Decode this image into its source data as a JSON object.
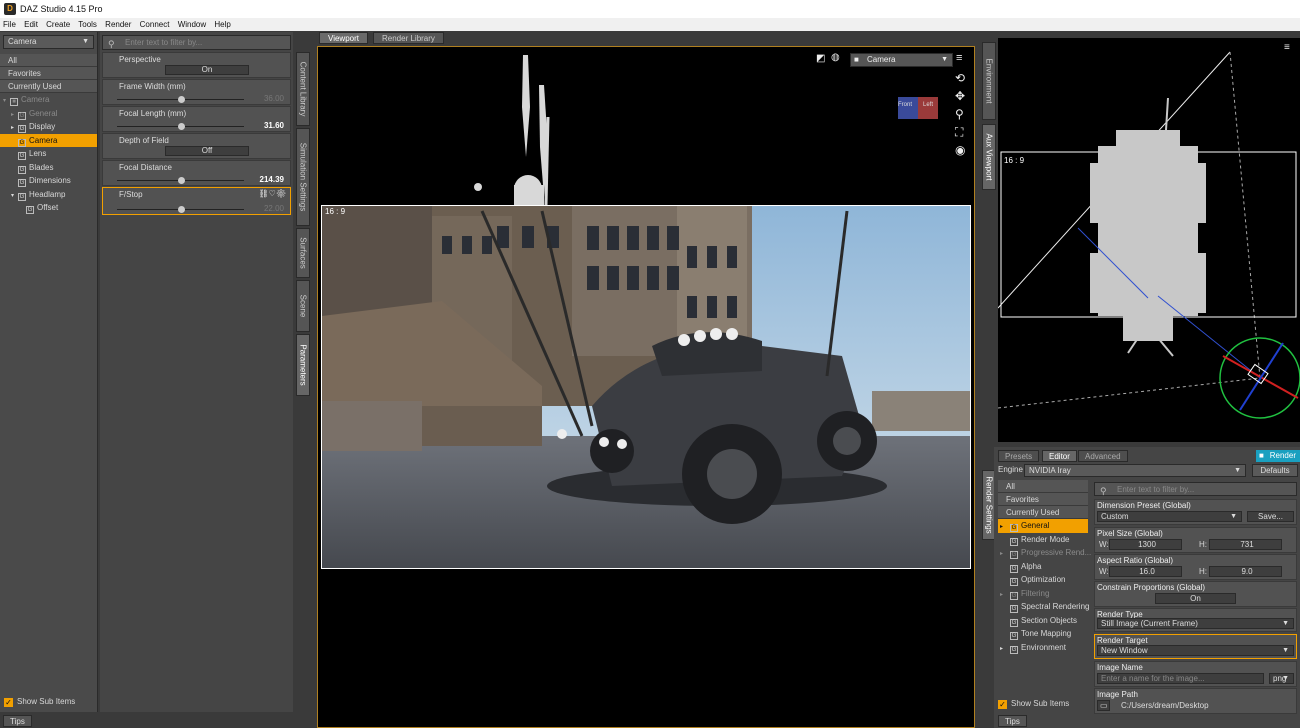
{
  "app": {
    "title": "DAZ Studio 4.15 Pro"
  },
  "menu": [
    "File",
    "Edit",
    "Create",
    "Tools",
    "Render",
    "Connect",
    "Window",
    "Help"
  ],
  "left_nav": {
    "node_select": "Camera",
    "categories": [
      "All",
      "Favorites",
      "Currently Used"
    ],
    "tree": [
      {
        "label": "Camera",
        "state": "dim",
        "expander": "▾",
        "indent": 0,
        "icon": "camera-icon"
      },
      {
        "label": "General",
        "state": "dim",
        "expander": "▸",
        "indent": 1,
        "icon": "group-icon"
      },
      {
        "label": "Display",
        "state": "normal",
        "expander": "▸",
        "indent": 1,
        "icon": "group-icon"
      },
      {
        "label": "Camera",
        "state": "selected",
        "expander": "",
        "indent": 1,
        "icon": "group-icon"
      },
      {
        "label": "Lens",
        "state": "normal",
        "expander": "",
        "indent": 1,
        "icon": "group-icon"
      },
      {
        "label": "Blades",
        "state": "normal",
        "expander": "",
        "indent": 1,
        "icon": "group-icon"
      },
      {
        "label": "Dimensions",
        "state": "normal",
        "expander": "",
        "indent": 1,
        "icon": "group-icon"
      },
      {
        "label": "Headlamp",
        "state": "normal",
        "expander": "▾",
        "indent": 1,
        "icon": "group-icon"
      },
      {
        "label": "Offset",
        "state": "normal",
        "expander": "",
        "indent": 2,
        "icon": "group-icon"
      }
    ],
    "show_sub_items": "Show Sub Items",
    "tips": "Tips"
  },
  "params": {
    "search_placeholder": "Enter text to filter by...",
    "items": [
      {
        "label": "Perspective",
        "kind": "toggle",
        "value": "On"
      },
      {
        "label": "Frame Width (mm)",
        "kind": "slider",
        "value": "36.00",
        "level": 0.5,
        "highlight": false
      },
      {
        "label": "Focal Length (mm)",
        "kind": "slider",
        "value": "31.60",
        "level": 0.5,
        "highlight": true
      },
      {
        "label": "Depth of Field",
        "kind": "toggle",
        "value": "Off"
      },
      {
        "label": "Focal Distance",
        "kind": "slider",
        "value": "214.39",
        "level": 0.5,
        "highlight": true
      },
      {
        "label": "F/Stop",
        "kind": "slider",
        "value": "22.00",
        "level": 0.5,
        "highlight": false,
        "selected": true
      }
    ]
  },
  "side_tabs": [
    "Content Library",
    "Simulation Settings",
    "Surfaces",
    "Scene",
    "Parameters"
  ],
  "viewport": {
    "tabs": [
      "Viewport",
      "Render Library"
    ],
    "camera": "Camera",
    "aspect_label": "16 : 9",
    "cube_left": "Left",
    "cube_front": "Front"
  },
  "aux": {
    "tabs": [
      "Environment",
      "Aux Viewport"
    ],
    "aspect_label": "16 : 9"
  },
  "render_settings": {
    "side_tab": "Render Settings",
    "tabs": [
      "Presets",
      "Editor",
      "Advanced"
    ],
    "render_button": "Render",
    "engine_label": "Engine :",
    "engine_value": "NVIDIA Iray",
    "defaults_button": "Defaults",
    "search_placeholder": "Enter text to filter by...",
    "categories": [
      "All",
      "Favorites",
      "Currently Used"
    ],
    "tree": [
      {
        "label": "General",
        "state": "selected",
        "expander": "▸"
      },
      {
        "label": "Render Mode",
        "state": "normal",
        "expander": ""
      },
      {
        "label": "Progressive Rend...",
        "state": "dim",
        "expander": "▸"
      },
      {
        "label": "Alpha",
        "state": "normal",
        "expander": ""
      },
      {
        "label": "Optimization",
        "state": "normal",
        "expander": ""
      },
      {
        "label": "Filtering",
        "state": "dim",
        "expander": "▸"
      },
      {
        "label": "Spectral Rendering",
        "state": "normal",
        "expander": ""
      },
      {
        "label": "Section Objects",
        "state": "normal",
        "expander": ""
      },
      {
        "label": "Tone Mapping",
        "state": "normal",
        "expander": ""
      },
      {
        "label": "Environment",
        "state": "normal",
        "expander": "▸"
      }
    ],
    "dimension_preset_label": "Dimension Preset (Global)",
    "dimension_preset_value": "Custom",
    "save_button": "Save...",
    "pixel_size_label": "Pixel Size (Global)",
    "w_label": "W:",
    "h_label": "H:",
    "pixel_w": "1300",
    "pixel_h": "731",
    "aspect_ratio_label": "Aspect Ratio (Global)",
    "aspect_w": "16.0",
    "aspect_h": "9.0",
    "constrain_label": "Constrain Proportions (Global)",
    "constrain_value": "On",
    "render_type_label": "Render Type",
    "render_type_value": "Still Image (Current Frame)",
    "render_target_label": "Render Target",
    "render_target_value": "New Window",
    "image_name_label": "Image Name",
    "image_name_placeholder": "Enter a name for the image...",
    "image_ext": "png",
    "image_path_label": "Image Path",
    "image_path_value": "C:/Users/dream/Desktop",
    "show_sub_items": "Show Sub Items",
    "tips": "Tips"
  },
  "colors": {
    "accent": "#f2a000",
    "panel": "#454545",
    "viewport_bg": "#000000"
  }
}
